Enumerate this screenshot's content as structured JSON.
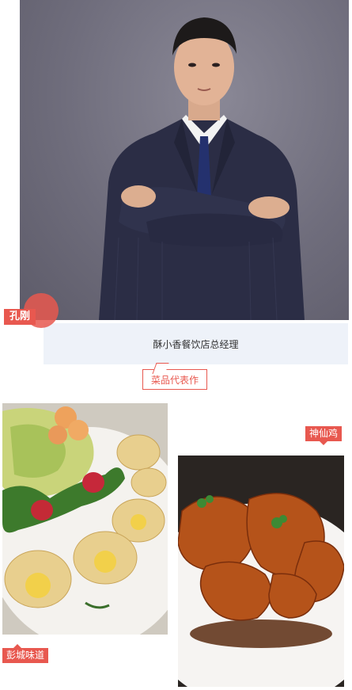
{
  "chef": {
    "name": "孔刚",
    "title": "酥小香餐饮店总经理"
  },
  "section": {
    "label": "菜品代表作"
  },
  "dishes": [
    {
      "name": "彭城味道"
    },
    {
      "name": "神仙鸡"
    }
  ],
  "colors": {
    "accent": "#e8584f",
    "title_box_bg": "#eef2f9"
  }
}
